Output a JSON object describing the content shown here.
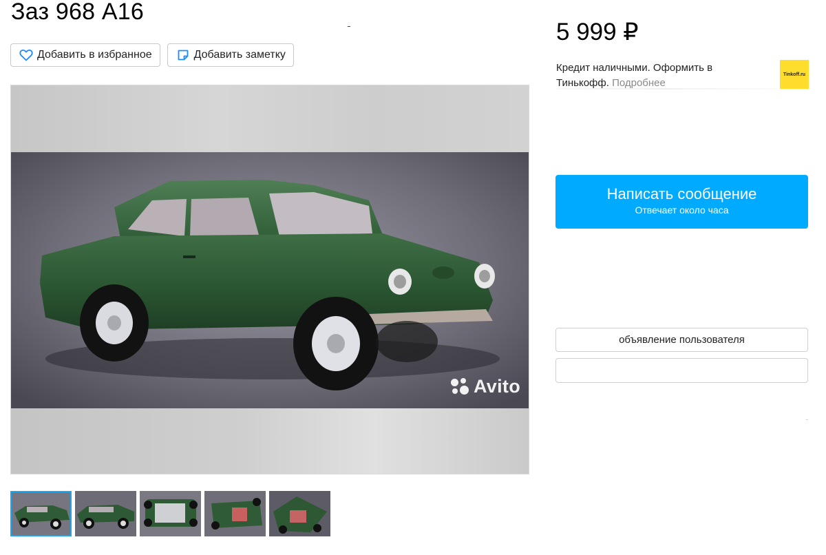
{
  "listing": {
    "title": "Заз 968 А16",
    "price": "5 999 ₽"
  },
  "actions": {
    "favorite_label": "Добавить в избранное",
    "note_label": "Добавить заметку"
  },
  "credit": {
    "text": "Кредит наличными. Оформить в Тинькофф.",
    "more_link": "Подробнее",
    "bank_logo_text": "Tinkoff.ru",
    "bank_logo_color": "#ffdd2d"
  },
  "message_button": {
    "label": "Написать сообщение",
    "sublabel": "Отвечает около часа",
    "color": "#00aaff"
  },
  "seller": {
    "user_listing_label": "объявление пользователя"
  },
  "gallery": {
    "watermark": "Avito",
    "thumbnail_count": 5,
    "active_thumbnail": 1,
    "accent": "#1aa7f0"
  }
}
